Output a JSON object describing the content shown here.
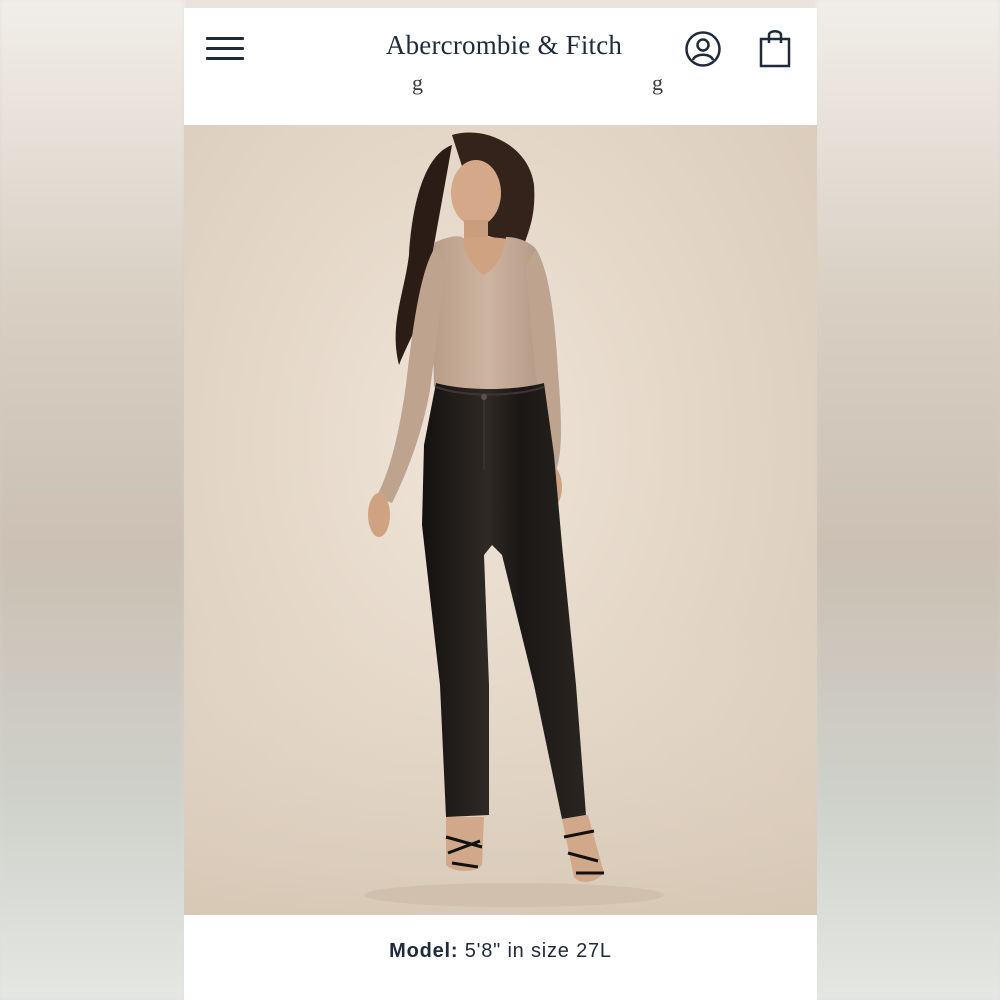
{
  "header": {
    "brand": "Abercrombie & Fitch",
    "menu_icon": "hamburger-menu-icon",
    "account_icon": "user-account-icon",
    "bag_icon": "shopping-bag-icon"
  },
  "product_image": {
    "description_icon": "model-photo",
    "colors": {
      "background": "#e6d9ca",
      "top": "#c4ab96",
      "pants": "#1f1b18"
    }
  },
  "caption": {
    "label": "Model:",
    "value": "5'8\" in size 27L"
  },
  "colors": {
    "text_primary": "#1f2a3a",
    "page_bg": "#ffffff"
  }
}
